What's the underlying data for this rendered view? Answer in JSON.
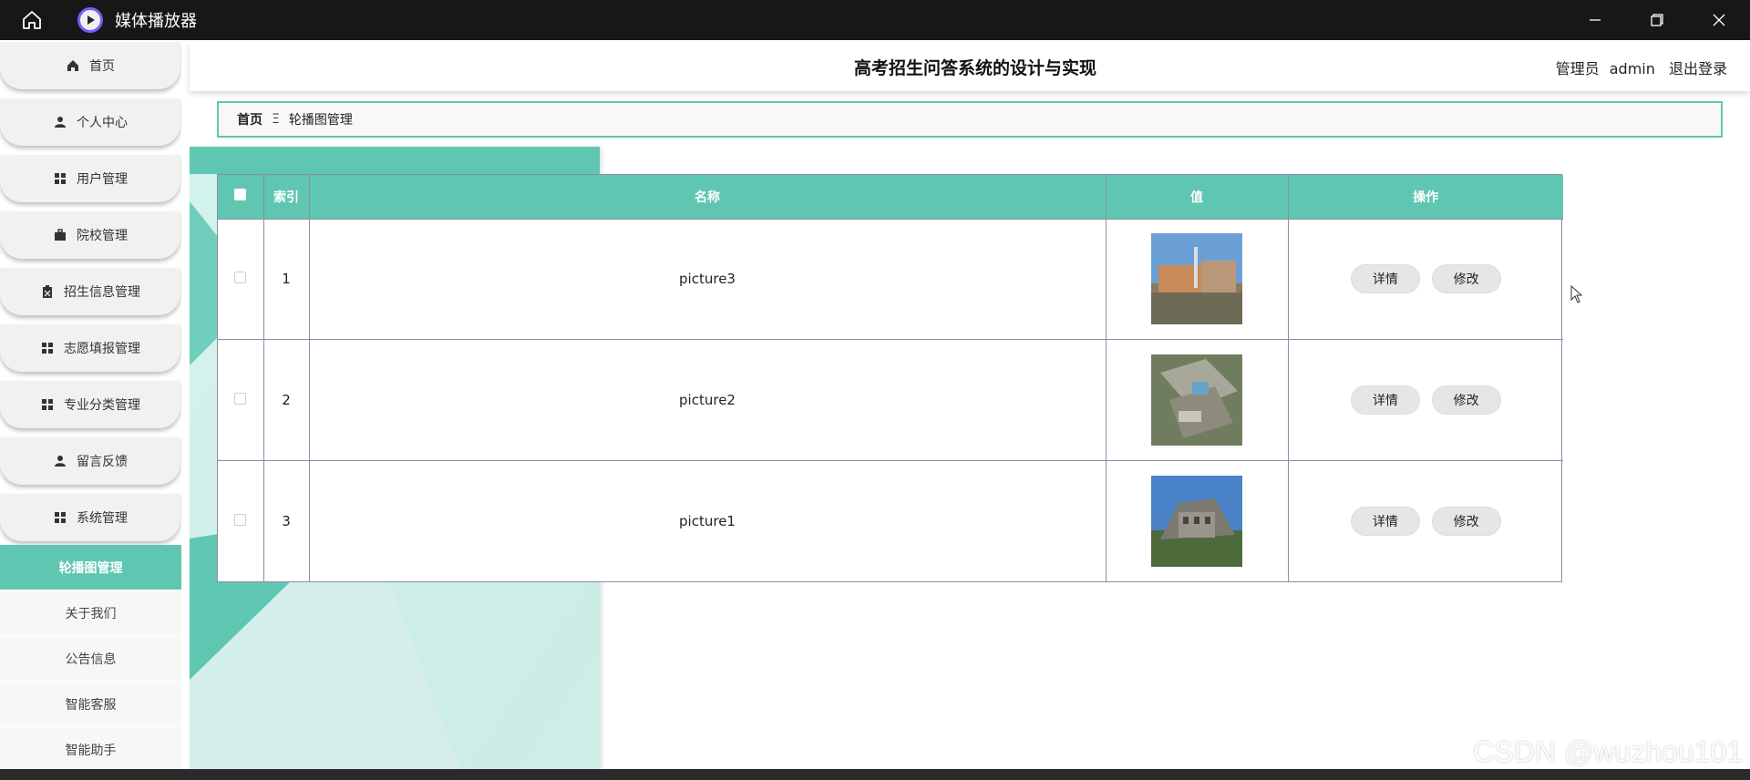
{
  "window": {
    "app_title": "媒体播放器"
  },
  "sidebar": {
    "items": [
      {
        "label": "首页",
        "icon": "home-icon"
      },
      {
        "label": "个人中心",
        "icon": "user-icon"
      },
      {
        "label": "用户管理",
        "icon": "grid-icon"
      },
      {
        "label": "院校管理",
        "icon": "briefcase-icon"
      },
      {
        "label": "招生信息管理",
        "icon": "clipboard-icon"
      },
      {
        "label": "志愿填报管理",
        "icon": "grid-icon"
      },
      {
        "label": "专业分类管理",
        "icon": "grid-icon"
      },
      {
        "label": "留言反馈",
        "icon": "user-icon"
      },
      {
        "label": "系统管理",
        "icon": "grid-icon"
      }
    ],
    "sub_items": [
      {
        "label": "轮播图管理",
        "active": true
      },
      {
        "label": "关于我们",
        "active": false
      },
      {
        "label": "公告信息",
        "active": false
      },
      {
        "label": "智能客服",
        "active": false
      },
      {
        "label": "智能助手",
        "active": false
      }
    ]
  },
  "header": {
    "title": "高考招生问答系统的设计与实现",
    "role": "管理员",
    "username": "admin",
    "logout": "退出登录"
  },
  "breadcrumb": {
    "home": "首页",
    "separator": "Ξ",
    "current": "轮播图管理"
  },
  "table": {
    "columns": [
      "",
      "索引",
      "名称",
      "值",
      "操作"
    ],
    "rows": [
      {
        "index": "1",
        "name": "picture3",
        "image": "campus-photo-1",
        "detail": "详情",
        "edit": "修改"
      },
      {
        "index": "2",
        "name": "picture2",
        "image": "campus-aerial-photo",
        "detail": "详情",
        "edit": "修改"
      },
      {
        "index": "3",
        "name": "picture1",
        "image": "campus-building-photo",
        "detail": "详情",
        "edit": "修改"
      }
    ]
  },
  "watermark": "CSDN @wuzhou101",
  "colors": {
    "accent": "#5fc6b2",
    "titlebar": "#171717"
  }
}
